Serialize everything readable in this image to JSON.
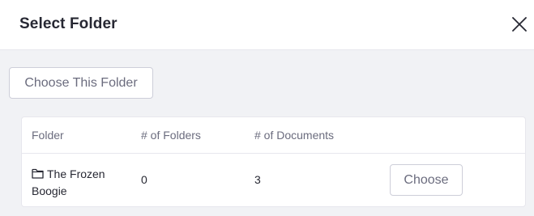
{
  "modal": {
    "title": "Select Folder",
    "close_icon": "close-icon"
  },
  "toolbar": {
    "choose_this_folder_label": "Choose This Folder"
  },
  "table": {
    "columns": [
      "Folder",
      "# of Folders",
      "# of Documents",
      ""
    ],
    "rows": [
      {
        "icon": "folder-icon",
        "folder": "The Frozen Boogie",
        "num_folders": "0",
        "num_documents": "3",
        "action_label": "Choose"
      }
    ]
  },
  "colors": {
    "header_bg": "#ffffff",
    "body_bg": "#f1f2f5",
    "text_primary": "#272833",
    "text_secondary": "#6b6c7e",
    "border": "#cdced9"
  }
}
